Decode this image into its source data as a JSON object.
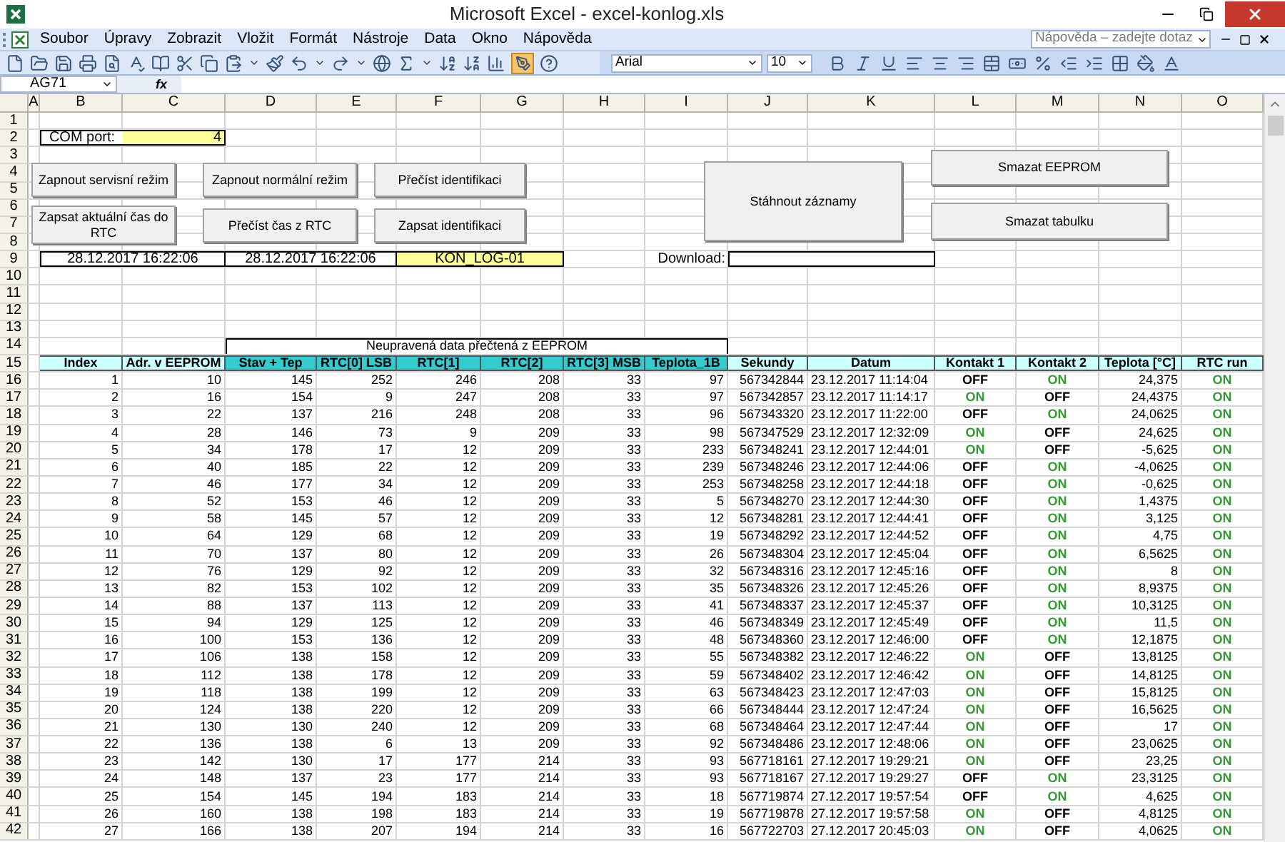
{
  "window": {
    "title": "Microsoft Excel - excel-konlog.xls"
  },
  "menu": [
    "Soubor",
    "Úpravy",
    "Zobrazit",
    "Vložit",
    "Formát",
    "Nástroje",
    "Data",
    "Okno",
    "Nápověda"
  ],
  "help_search": {
    "placeholder": "Nápověda – zadejte dotaz"
  },
  "formatting": {
    "font": "Arial",
    "size": "10"
  },
  "formula_bar": {
    "name_box": "AG71",
    "label": "fx"
  },
  "column_headers": [
    "A",
    "B",
    "C",
    "D",
    "E",
    "F",
    "G",
    "H",
    "I",
    "J",
    "K",
    "L",
    "M",
    "N",
    "O"
  ],
  "row_numbers": [
    "1",
    "2",
    "3",
    "4",
    "5",
    "6",
    "7",
    "8",
    "9",
    "10",
    "11",
    "12",
    "13",
    "14",
    "15",
    "16",
    "17",
    "18",
    "19",
    "20",
    "21",
    "22",
    "23",
    "24",
    "25",
    "26",
    "27",
    "28",
    "29",
    "30",
    "31",
    "32",
    "33",
    "34",
    "35",
    "36",
    "37",
    "38",
    "39",
    "40",
    "41",
    "42"
  ],
  "settings": {
    "com_port_label": "COM port:",
    "com_port": "4",
    "pc_time": "28.12.2017 16:22:06",
    "rtc_time": "28.12.2017 16:22:06",
    "identification": "KON_LOG-01",
    "download_label": "Download:"
  },
  "buttons": [
    "Zapnout servisní režim",
    "Zapnout normální režim",
    "Přečíst identifikaci",
    "Zapsat aktuální čas do RTC",
    "Přečíst čas z RTC",
    "Zapsat identifikaci",
    "Stáhnout záznamy",
    "Smazat EEPROM",
    "Smazat tabulku"
  ],
  "table": {
    "title": "Neupravená data přečtená z EEPROM",
    "columns": [
      {
        "label": "Index",
        "kind": "decoded"
      },
      {
        "label": "Adr. v EEPROM",
        "kind": "decoded"
      },
      {
        "label": "Stav + Tep",
        "kind": "raw"
      },
      {
        "label": "RTC[0] LSB",
        "kind": "raw"
      },
      {
        "label": "RTC[1]",
        "kind": "raw"
      },
      {
        "label": "RTC[2]",
        "kind": "raw"
      },
      {
        "label": "RTC[3] MSB",
        "kind": "raw"
      },
      {
        "label": "Teplota_1B",
        "kind": "raw"
      },
      {
        "label": "Sekundy",
        "kind": "decoded"
      },
      {
        "label": "Datum",
        "kind": "decoded"
      },
      {
        "label": "Kontakt 1",
        "kind": "decoded"
      },
      {
        "label": "Kontakt 2",
        "kind": "decoded"
      },
      {
        "label": "Teplota [°C]",
        "kind": "decoded"
      },
      {
        "label": "RTC run",
        "kind": "decoded"
      }
    ],
    "rows": [
      {
        "cells": [
          "1",
          "10",
          "145",
          "252",
          "246",
          "208",
          "33",
          "97",
          "567342844",
          "23.12.2017 11:14:04",
          {
            "text": "OFF",
            "on": false
          },
          {
            "text": "ON",
            "on": true
          },
          "24,375",
          {
            "text": "ON",
            "on": true
          }
        ]
      },
      {
        "cells": [
          "2",
          "16",
          "154",
          "9",
          "247",
          "208",
          "33",
          "97",
          "567342857",
          "23.12.2017 11:14:17",
          {
            "text": "ON",
            "on": true
          },
          {
            "text": "OFF",
            "on": false
          },
          "24,4375",
          {
            "text": "ON",
            "on": true
          }
        ]
      },
      {
        "cells": [
          "3",
          "22",
          "137",
          "216",
          "248",
          "208",
          "33",
          "96",
          "567343320",
          "23.12.2017 11:22:00",
          {
            "text": "OFF",
            "on": false
          },
          {
            "text": "ON",
            "on": true
          },
          "24,0625",
          {
            "text": "ON",
            "on": true
          }
        ]
      },
      {
        "cells": [
          "4",
          "28",
          "146",
          "73",
          "9",
          "209",
          "33",
          "98",
          "567347529",
          "23.12.2017 12:32:09",
          {
            "text": "ON",
            "on": true
          },
          {
            "text": "OFF",
            "on": false
          },
          "24,625",
          {
            "text": "ON",
            "on": true
          }
        ]
      },
      {
        "cells": [
          "5",
          "34",
          "178",
          "17",
          "12",
          "209",
          "33",
          "233",
          "567348241",
          "23.12.2017 12:44:01",
          {
            "text": "ON",
            "on": true
          },
          {
            "text": "OFF",
            "on": false
          },
          "-5,625",
          {
            "text": "ON",
            "on": true
          }
        ]
      },
      {
        "cells": [
          "6",
          "40",
          "185",
          "22",
          "12",
          "209",
          "33",
          "239",
          "567348246",
          "23.12.2017 12:44:06",
          {
            "text": "OFF",
            "on": false
          },
          {
            "text": "ON",
            "on": true
          },
          "-4,0625",
          {
            "text": "ON",
            "on": true
          }
        ]
      },
      {
        "cells": [
          "7",
          "46",
          "177",
          "34",
          "12",
          "209",
          "33",
          "253",
          "567348258",
          "23.12.2017 12:44:18",
          {
            "text": "OFF",
            "on": false
          },
          {
            "text": "ON",
            "on": true
          },
          "-0,625",
          {
            "text": "ON",
            "on": true
          }
        ]
      },
      {
        "cells": [
          "8",
          "52",
          "153",
          "46",
          "12",
          "209",
          "33",
          "5",
          "567348270",
          "23.12.2017 12:44:30",
          {
            "text": "OFF",
            "on": false
          },
          {
            "text": "ON",
            "on": true
          },
          "1,4375",
          {
            "text": "ON",
            "on": true
          }
        ]
      },
      {
        "cells": [
          "9",
          "58",
          "145",
          "57",
          "12",
          "209",
          "33",
          "12",
          "567348281",
          "23.12.2017 12:44:41",
          {
            "text": "OFF",
            "on": false
          },
          {
            "text": "ON",
            "on": true
          },
          "3,125",
          {
            "text": "ON",
            "on": true
          }
        ]
      },
      {
        "cells": [
          "10",
          "64",
          "129",
          "68",
          "12",
          "209",
          "33",
          "19",
          "567348292",
          "23.12.2017 12:44:52",
          {
            "text": "OFF",
            "on": false
          },
          {
            "text": "ON",
            "on": true
          },
          "4,75",
          {
            "text": "ON",
            "on": true
          }
        ]
      },
      {
        "cells": [
          "11",
          "70",
          "137",
          "80",
          "12",
          "209",
          "33",
          "26",
          "567348304",
          "23.12.2017 12:45:04",
          {
            "text": "OFF",
            "on": false
          },
          {
            "text": "ON",
            "on": true
          },
          "6,5625",
          {
            "text": "ON",
            "on": true
          }
        ]
      },
      {
        "cells": [
          "12",
          "76",
          "129",
          "92",
          "12",
          "209",
          "33",
          "32",
          "567348316",
          "23.12.2017 12:45:16",
          {
            "text": "OFF",
            "on": false
          },
          {
            "text": "ON",
            "on": true
          },
          "8",
          {
            "text": "ON",
            "on": true
          }
        ]
      },
      {
        "cells": [
          "13",
          "82",
          "153",
          "102",
          "12",
          "209",
          "33",
          "35",
          "567348326",
          "23.12.2017 12:45:26",
          {
            "text": "OFF",
            "on": false
          },
          {
            "text": "ON",
            "on": true
          },
          "8,9375",
          {
            "text": "ON",
            "on": true
          }
        ]
      },
      {
        "cells": [
          "14",
          "88",
          "137",
          "113",
          "12",
          "209",
          "33",
          "41",
          "567348337",
          "23.12.2017 12:45:37",
          {
            "text": "OFF",
            "on": false
          },
          {
            "text": "ON",
            "on": true
          },
          "10,3125",
          {
            "text": "ON",
            "on": true
          }
        ]
      },
      {
        "cells": [
          "15",
          "94",
          "129",
          "125",
          "12",
          "209",
          "33",
          "46",
          "567348349",
          "23.12.2017 12:45:49",
          {
            "text": "OFF",
            "on": false
          },
          {
            "text": "ON",
            "on": true
          },
          "11,5",
          {
            "text": "ON",
            "on": true
          }
        ]
      },
      {
        "cells": [
          "16",
          "100",
          "153",
          "136",
          "12",
          "209",
          "33",
          "48",
          "567348360",
          "23.12.2017 12:46:00",
          {
            "text": "OFF",
            "on": false
          },
          {
            "text": "ON",
            "on": true
          },
          "12,1875",
          {
            "text": "ON",
            "on": true
          }
        ]
      },
      {
        "cells": [
          "17",
          "106",
          "138",
          "158",
          "12",
          "209",
          "33",
          "55",
          "567348382",
          "23.12.2017 12:46:22",
          {
            "text": "ON",
            "on": true
          },
          {
            "text": "OFF",
            "on": false
          },
          "13,8125",
          {
            "text": "ON",
            "on": true
          }
        ]
      },
      {
        "cells": [
          "18",
          "112",
          "138",
          "178",
          "12",
          "209",
          "33",
          "59",
          "567348402",
          "23.12.2017 12:46:42",
          {
            "text": "ON",
            "on": true
          },
          {
            "text": "OFF",
            "on": false
          },
          "14,8125",
          {
            "text": "ON",
            "on": true
          }
        ]
      },
      {
        "cells": [
          "19",
          "118",
          "138",
          "199",
          "12",
          "209",
          "33",
          "63",
          "567348423",
          "23.12.2017 12:47:03",
          {
            "text": "ON",
            "on": true
          },
          {
            "text": "OFF",
            "on": false
          },
          "15,8125",
          {
            "text": "ON",
            "on": true
          }
        ]
      },
      {
        "cells": [
          "20",
          "124",
          "138",
          "220",
          "12",
          "209",
          "33",
          "66",
          "567348444",
          "23.12.2017 12:47:24",
          {
            "text": "ON",
            "on": true
          },
          {
            "text": "OFF",
            "on": false
          },
          "16,5625",
          {
            "text": "ON",
            "on": true
          }
        ]
      },
      {
        "cells": [
          "21",
          "130",
          "130",
          "240",
          "12",
          "209",
          "33",
          "68",
          "567348464",
          "23.12.2017 12:47:44",
          {
            "text": "ON",
            "on": true
          },
          {
            "text": "OFF",
            "on": false
          },
          "17",
          {
            "text": "ON",
            "on": true
          }
        ]
      },
      {
        "cells": [
          "22",
          "136",
          "138",
          "6",
          "13",
          "209",
          "33",
          "92",
          "567348486",
          "23.12.2017 12:48:06",
          {
            "text": "ON",
            "on": true
          },
          {
            "text": "OFF",
            "on": false
          },
          "23,0625",
          {
            "text": "ON",
            "on": true
          }
        ]
      },
      {
        "cells": [
          "23",
          "142",
          "130",
          "17",
          "177",
          "214",
          "33",
          "93",
          "567718161",
          "27.12.2017 19:29:21",
          {
            "text": "ON",
            "on": true
          },
          {
            "text": "OFF",
            "on": false
          },
          "23,25",
          {
            "text": "ON",
            "on": true
          }
        ]
      },
      {
        "cells": [
          "24",
          "148",
          "137",
          "23",
          "177",
          "214",
          "33",
          "93",
          "567718167",
          "27.12.2017 19:29:27",
          {
            "text": "OFF",
            "on": false
          },
          {
            "text": "ON",
            "on": true
          },
          "23,3125",
          {
            "text": "ON",
            "on": true
          }
        ]
      },
      {
        "cells": [
          "25",
          "154",
          "145",
          "194",
          "183",
          "214",
          "33",
          "18",
          "567719874",
          "27.12.2017 19:57:54",
          {
            "text": "OFF",
            "on": false
          },
          {
            "text": "ON",
            "on": true
          },
          "4,625",
          {
            "text": "ON",
            "on": true
          }
        ]
      },
      {
        "cells": [
          "26",
          "160",
          "138",
          "198",
          "183",
          "214",
          "33",
          "19",
          "567719878",
          "27.12.2017 19:57:58",
          {
            "text": "ON",
            "on": true
          },
          {
            "text": "OFF",
            "on": false
          },
          "4,8125",
          {
            "text": "ON",
            "on": true
          }
        ]
      },
      {
        "cells": [
          "27",
          "166",
          "138",
          "207",
          "194",
          "214",
          "33",
          "16",
          "567722703",
          "27.12.2017 20:45:03",
          {
            "text": "ON",
            "on": true
          },
          {
            "text": "OFF",
            "on": false
          },
          "4,0625",
          {
            "text": "ON",
            "on": true
          }
        ]
      }
    ]
  }
}
